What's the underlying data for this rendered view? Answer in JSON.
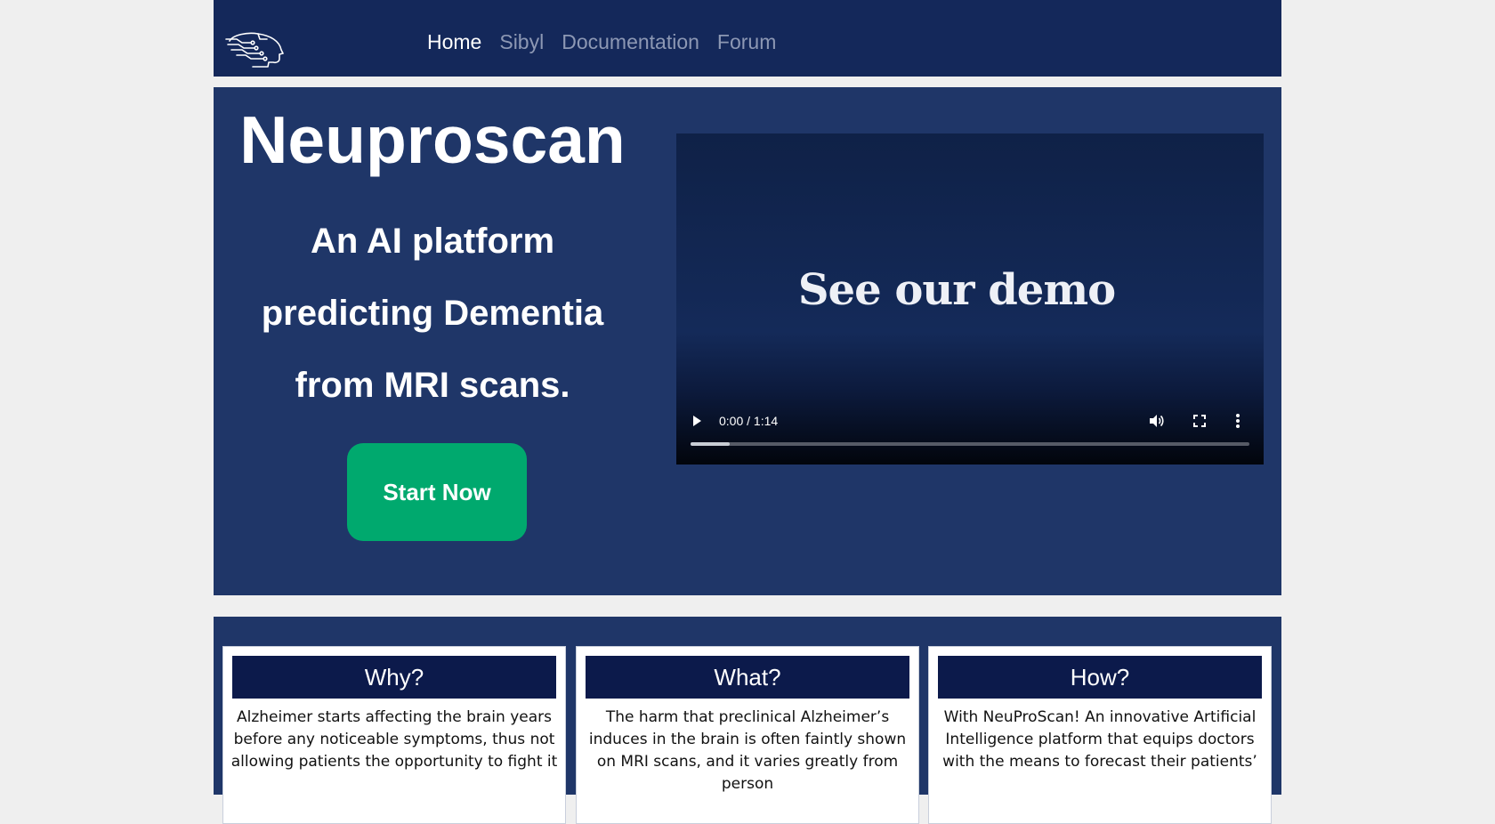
{
  "nav": {
    "items": [
      {
        "label": "Home",
        "active": true
      },
      {
        "label": "Sibyl",
        "active": false
      },
      {
        "label": "Documentation",
        "active": false
      },
      {
        "label": "Forum",
        "active": false
      }
    ],
    "logo_icon": "brain-circuit-head-icon"
  },
  "hero": {
    "title": "Neuproscan",
    "subtitle_lines": [
      "An AI platform",
      "predicting Dementia",
      "from MRI scans."
    ],
    "cta_label": "Start Now"
  },
  "video": {
    "title": "See our demo",
    "time": "0:00 / 1:14",
    "progress": 0.07
  },
  "features": [
    {
      "heading": "Why?",
      "text": "Alzheimer starts affecting the brain years before any noticeable symptoms, thus not allowing patients the opportunity to fight it"
    },
    {
      "heading": "What?",
      "text": "The harm that preclinical Alzheimer’s induces in the brain is often faintly shown on MRI scans, and it varies greatly from person"
    },
    {
      "heading": "How?",
      "text": "With NeuProScan! An innovative Artificial Intelligence platform that equips doctors with the means to forecast their patients’"
    }
  ],
  "colors": {
    "navbar": "#14285a",
    "hero": "#1f3668",
    "cta": "#00a96e",
    "card_head": "#0c1a4b"
  }
}
